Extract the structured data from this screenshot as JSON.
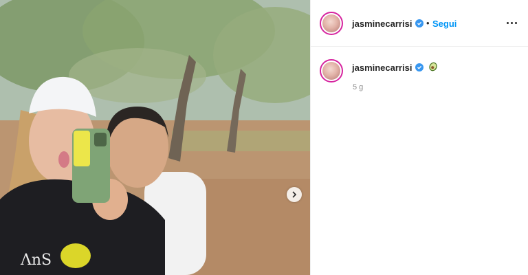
{
  "post": {
    "username": "jasminecarrisi",
    "follow_label": "Segui",
    "separator": "•",
    "caption_emoji": "avocado-icon",
    "timestamp": "5 g"
  },
  "icons": {
    "verified": "verified-badge-icon",
    "more": "more-options-icon",
    "next": "chevron-right-icon"
  },
  "colors": {
    "link_blue": "#0095f6",
    "verified_blue": "#3897f0",
    "text": "#262626",
    "muted": "#8e8e8e",
    "story_ring": "#d6249f"
  }
}
